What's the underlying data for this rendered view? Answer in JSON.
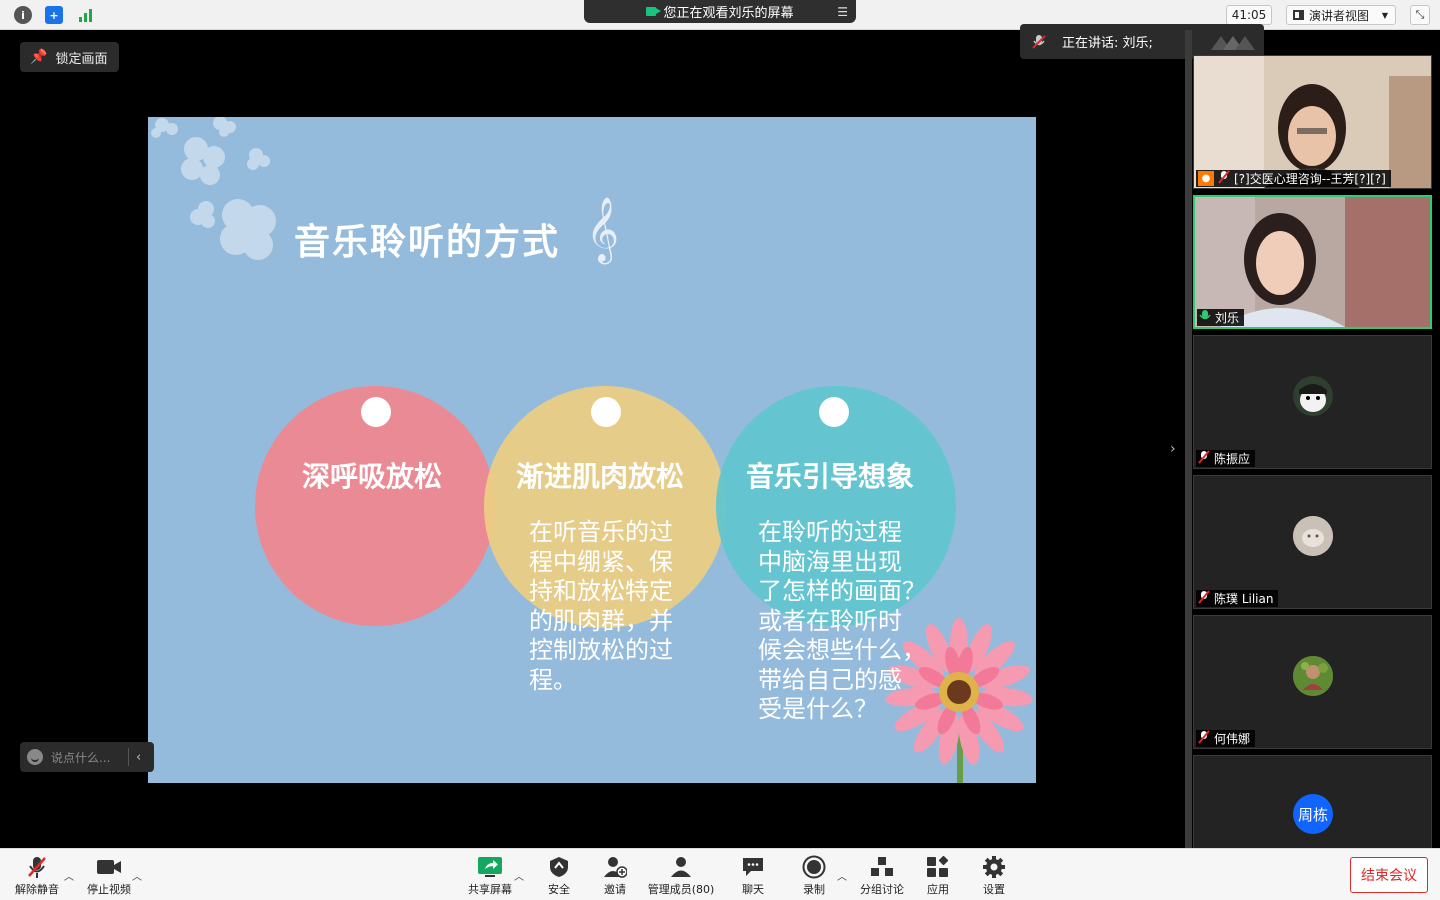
{
  "topbar": {
    "icons": [
      "info-icon",
      "shield-icon",
      "signal-icon"
    ],
    "share_banner": "您正在观看刘乐的屏幕",
    "timer": "41:05",
    "view_mode": "演讲者视图"
  },
  "lock_button": "锁定画面",
  "slide": {
    "title": "音乐聆听的方式",
    "clef": "𝄞",
    "circles": [
      {
        "title": "深呼吸放松",
        "body": "",
        "color": "#ea8a95"
      },
      {
        "title": "渐进肌肉放松",
        "body_lines": [
          "在听音乐的过",
          "程中绷紧、保",
          "持和放松特定",
          "的肌肉群，并",
          "控制放松的过",
          "程。"
        ],
        "color": "#ecce82"
      },
      {
        "title": "音乐引导想象",
        "body_lines": [
          "在聆听的过程",
          "中脑海里出现",
          "了怎样的画面？",
          "或者在聆听时",
          "候会想些什么，",
          "带给自己的感",
          "受是什么？"
        ],
        "color": "#60c6ce"
      }
    ]
  },
  "speaking": "正在讲话: 刘乐;",
  "participants": [
    {
      "name": "[?]交医心理咨询--王芳[?][?]",
      "type": "video",
      "active": false
    },
    {
      "name": "刘乐",
      "type": "video",
      "active": true
    },
    {
      "name": "陈振应",
      "type": "avatar",
      "active": false
    },
    {
      "name": "陈璞 Lilian",
      "type": "avatar",
      "active": false
    },
    {
      "name": "何伟娜",
      "type": "avatar",
      "active": false
    },
    {
      "name": "周栋",
      "type": "initials",
      "initials": "周栋",
      "active": false
    }
  ],
  "chat_placeholder": "说点什么...",
  "toolbar": {
    "unmute": "解除静音",
    "stop_video": "停止视频",
    "share": "共享屏幕",
    "security": "安全",
    "invite": "邀请",
    "participants": "管理成员(80)",
    "chat": "聊天",
    "record": "录制",
    "breakout": "分组讨论",
    "apps": "应用",
    "settings": "设置",
    "end": "结束会议"
  },
  "colors": {
    "slide_bg": "#95bbdc",
    "active_border": "#2ecc71",
    "end_button": "#e02828",
    "initials_avatar": "#1264ff"
  }
}
